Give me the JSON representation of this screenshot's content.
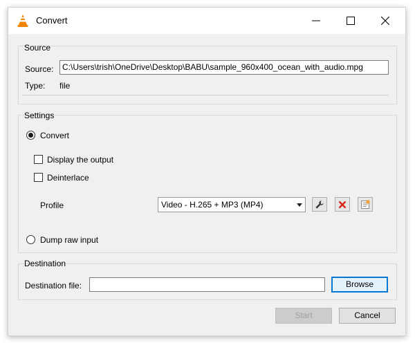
{
  "window": {
    "title": "Convert",
    "icon": "vlc-cone-icon",
    "controls": [
      "minimize-icon",
      "maximize-icon",
      "close-icon"
    ]
  },
  "source": {
    "group_label": "Source",
    "source_label": "Source:",
    "source_value": "C:\\Users\\trish\\OneDrive\\Desktop\\BABU\\sample_960x400_ocean_with_audio.mpg",
    "type_label": "Type:",
    "type_value": "file"
  },
  "settings": {
    "group_label": "Settings",
    "convert_label": "Convert",
    "convert_checked": true,
    "display_output_label": "Display the output",
    "display_output_checked": false,
    "deinterlace_label": "Deinterlace",
    "deinterlace_checked": false,
    "profile_label": "Profile",
    "profile_value": "Video - H.265 + MP3 (MP4)",
    "profile_tools": [
      "wrench-icon",
      "delete-x-icon",
      "new-profile-icon"
    ],
    "dump_raw_label": "Dump raw input",
    "dump_raw_checked": false
  },
  "destination": {
    "group_label": "Destination",
    "file_label": "Destination file:",
    "file_value": "",
    "browse_label": "Browse"
  },
  "footer": {
    "start_label": "Start",
    "cancel_label": "Cancel"
  },
  "colors": {
    "vlc_orange": "#f08300",
    "delete_red": "#d9241c",
    "focus_blue": "#0078d7"
  }
}
